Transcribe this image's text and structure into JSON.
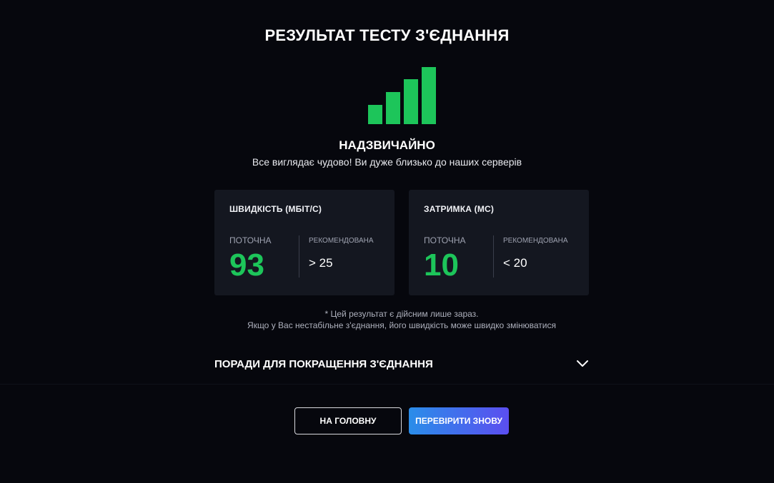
{
  "page": {
    "title": "РЕЗУЛЬТАТ ТЕСТУ З'ЄДНАННЯ"
  },
  "signal": {
    "icon": "signal-bars-icon",
    "color": "#1dc55a",
    "level": 4,
    "max_level": 4
  },
  "rating": {
    "label": "НАДЗВИЧАЙНО",
    "description": "Все виглядає чудово! Ви дуже близько до наших серверів"
  },
  "speed_card": {
    "title": "ШВИДКІСТЬ (МБІТ/С)",
    "current_label": "ПОТОЧНА",
    "current_value": "93",
    "recommended_label": "РЕКОМЕНДОВАНА",
    "recommended_value": "> 25"
  },
  "latency_card": {
    "title": "ЗАТРИМКА (МС)",
    "current_label": "ПОТОЧНА",
    "current_value": "10",
    "recommended_label": "РЕКОМЕНДОВАНА",
    "recommended_value": "< 20"
  },
  "note": {
    "line1": "* Цей результат є дійсним лише зараз.",
    "line2": "Якщо у Вас нестабільне з'єднання, його швидкість може швидко змінюватися"
  },
  "tips": {
    "label": "ПОРАДИ ДЛЯ ПОКРАЩЕННЯ З'ЄДНАННЯ",
    "icon": "chevron-down-icon"
  },
  "buttons": {
    "home_label": "НА ГОЛОВНУ",
    "retry_label": "ПЕРЕВІРИТИ ЗНОВУ"
  },
  "colors": {
    "background": "#06070d",
    "card": "#141720",
    "accent_green": "#1dc55a",
    "gradient_start": "#2a8de9",
    "gradient_end": "#5b4ef0"
  }
}
